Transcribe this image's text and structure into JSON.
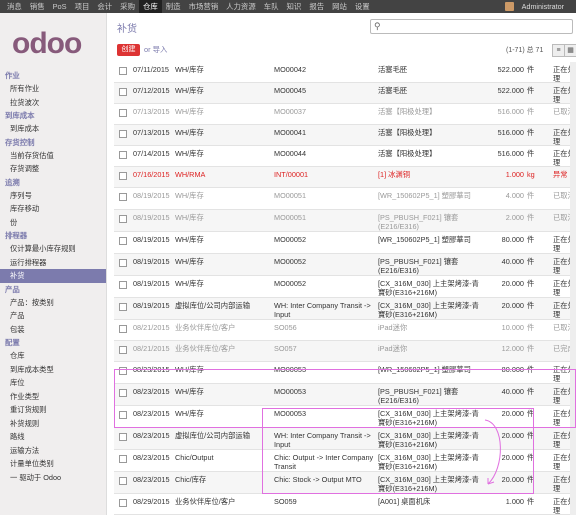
{
  "topbar": {
    "menu": [
      "消息",
      "销售",
      "PoS",
      "项目",
      "会计",
      "采购",
      "仓库",
      "制造",
      "市场营销",
      "人力资源",
      "车队",
      "知识",
      "报告",
      "网站",
      "设置"
    ],
    "active_index": 6,
    "user": "Administrator"
  },
  "logo": "odoo",
  "sidebar": [
    {
      "type": "sec",
      "label": "作业"
    },
    {
      "type": "it",
      "label": "所有作业"
    },
    {
      "type": "it",
      "label": "拉货波次"
    },
    {
      "type": "sec",
      "label": "到库成本"
    },
    {
      "type": "it",
      "label": "到库成本"
    },
    {
      "type": "sec",
      "label": "存货控制"
    },
    {
      "type": "it",
      "label": "当前存货估值"
    },
    {
      "type": "it",
      "label": "存货调整"
    },
    {
      "type": "sec",
      "label": "追溯"
    },
    {
      "type": "it",
      "label": "序列号"
    },
    {
      "type": "it",
      "label": "库存移动"
    },
    {
      "type": "it",
      "label": "份"
    },
    {
      "type": "sec",
      "label": "排程器"
    },
    {
      "type": "it",
      "label": "仅计算最小库存规则"
    },
    {
      "type": "it",
      "label": "运行排程器"
    },
    {
      "type": "it",
      "label": "补货",
      "active": true
    },
    {
      "type": "sec",
      "label": "产品"
    },
    {
      "type": "it",
      "label": "产品：按类别"
    },
    {
      "type": "it",
      "label": "产品"
    },
    {
      "type": "it",
      "label": "包装"
    },
    {
      "type": "sec",
      "label": "配置"
    },
    {
      "type": "it",
      "label": "仓库"
    },
    {
      "type": "it",
      "label": "到库成本类型"
    },
    {
      "type": "it",
      "label": "库位"
    },
    {
      "type": "it",
      "label": "作业类型"
    },
    {
      "type": "it",
      "label": "重订货规则"
    },
    {
      "type": "it",
      "label": "补货规则"
    },
    {
      "type": "it",
      "label": "路线"
    },
    {
      "type": "it",
      "label": "运输方法"
    },
    {
      "type": "it",
      "label": "计量单位类别"
    },
    {
      "type": "it",
      "label": "一 驱动于 Odoo"
    }
  ],
  "breadcrumb": "补货",
  "search": {
    "placeholder": ""
  },
  "toolbar": {
    "create": "创建",
    "or": "or",
    "import": "导入"
  },
  "pager": "(1-71) 总 71",
  "rows": [
    {
      "date": "07/11/2015",
      "loc": "WH/库存",
      "ref": "MO00042",
      "prod": "活塞毛胚",
      "qty": "522.000",
      "uom": "件",
      "st": "正在处理",
      "kind": "normal"
    },
    {
      "date": "07/12/2015",
      "loc": "WH/库存",
      "ref": "MO00045",
      "prod": "活塞毛胚",
      "qty": "522.000",
      "uom": "件",
      "st": "正在处理",
      "kind": "normal"
    },
    {
      "date": "07/13/2015",
      "loc": "WH/库存",
      "ref": "MO00037",
      "prod": "活塞【阳极处理】",
      "qty": "516.000",
      "uom": "件",
      "st": "已取消",
      "kind": "grey"
    },
    {
      "date": "07/13/2015",
      "loc": "WH/库存",
      "ref": "MO00041",
      "prod": "活塞【阳极处理】",
      "qty": "516.000",
      "uom": "件",
      "st": "正在处理",
      "kind": "normal"
    },
    {
      "date": "07/14/2015",
      "loc": "WH/库存",
      "ref": "MO00044",
      "prod": "活塞【阳极处理】",
      "qty": "516.000",
      "uom": "件",
      "st": "正在处理",
      "kind": "normal"
    },
    {
      "date": "07/16/2015",
      "loc": "WH/RMA",
      "ref": "INT/00001",
      "prod": "[1] 冰渊铜",
      "qty": "1.000",
      "uom": "kg",
      "st": "异常",
      "kind": "red"
    },
    {
      "date": "08/19/2015",
      "loc": "WH/库存",
      "ref": "MO00051",
      "prod": "[WR_150602P5_1] 塑膠華司",
      "qty": "4.000",
      "uom": "件",
      "st": "已取消",
      "kind": "grey"
    },
    {
      "date": "08/19/2015",
      "loc": "WH/库存",
      "ref": "MO00051",
      "prod": "[PS_PBUSH_F021] 镶套 (E216/E316)",
      "qty": "2.000",
      "uom": "件",
      "st": "已取消",
      "kind": "grey"
    },
    {
      "date": "08/19/2015",
      "loc": "WH/库存",
      "ref": "MO00052",
      "prod": "[WR_150602P5_1] 塑膠華司",
      "qty": "80.000",
      "uom": "件",
      "st": "正在处理",
      "kind": "normal"
    },
    {
      "date": "08/19/2015",
      "loc": "WH/库存",
      "ref": "MO00052",
      "prod": "[PS_PBUSH_F021] 镶套 (E216/E316)",
      "qty": "40.000",
      "uom": "件",
      "st": "正在处理",
      "kind": "normal"
    },
    {
      "date": "08/19/2015",
      "loc": "WH/库存",
      "ref": "MO00052",
      "prod": "[CX_316M_030] 上主架烤漆-青寶砂(E316+216M)",
      "qty": "20.000",
      "uom": "件",
      "st": "正在处理",
      "kind": "normal"
    },
    {
      "date": "08/19/2015",
      "loc": "虚拟库位/公司内部运输",
      "ref": "WH: Inter Company Transit -> Input",
      "prod": "[CX_316M_030] 上主架烤漆-青寶砂(E316+216M)",
      "qty": "20.000",
      "uom": "件",
      "st": "正在处理",
      "kind": "normal"
    },
    {
      "date": "08/21/2015",
      "loc": "业务伙伴库位/客户",
      "ref": "SO056",
      "prod": "iPad迷你",
      "qty": "10.000",
      "uom": "件",
      "st": "已取消",
      "kind": "grey"
    },
    {
      "date": "08/21/2015",
      "loc": "业务伙伴库位/客户",
      "ref": "SO057",
      "prod": "iPad迷你",
      "qty": "12.000",
      "uom": "件",
      "st": "已完成",
      "kind": "grey"
    },
    {
      "date": "08/23/2015",
      "loc": "WH/库存",
      "ref": "MO00053",
      "prod": "[WR_150602P5_1] 塑膠華司",
      "qty": "80.000",
      "uom": "件",
      "st": "正在处理",
      "kind": "normal"
    },
    {
      "date": "08/23/2015",
      "loc": "WH/库存",
      "ref": "MO00053",
      "prod": "[PS_PBUSH_F021] 镶套 (E216/E316)",
      "qty": "40.000",
      "uom": "件",
      "st": "正在处理",
      "kind": "normal"
    },
    {
      "date": "08/23/2015",
      "loc": "WH/库存",
      "ref": "MO00053",
      "prod": "[CX_316M_030] 上主架烤漆-青寶砂(E316+216M)",
      "qty": "20.000",
      "uom": "件",
      "st": "正在处理",
      "kind": "normal"
    },
    {
      "date": "08/23/2015",
      "loc": "虚拟库位/公司内部运输",
      "ref": "WH: Inter Company Transit -> Input",
      "prod": "[CX_316M_030] 上主架烤漆-青寶砂(E316+216M)",
      "qty": "20.000",
      "uom": "件",
      "st": "正在处理",
      "kind": "normal"
    },
    {
      "date": "08/23/2015",
      "loc": "Chic/Output",
      "ref": "Chic: Output -> Inter Company Transit",
      "prod": "[CX_316M_030] 上主架烤漆-青寶砂(E316+216M)",
      "qty": "20.000",
      "uom": "件",
      "st": "正在处理",
      "kind": "normal"
    },
    {
      "date": "08/23/2015",
      "loc": "Chic/库存",
      "ref": "Chic: Stock -> Output MTO",
      "prod": "[CX_316M_030] 上主架烤漆-青寶砂(E316+216M)",
      "qty": "20.000",
      "uom": "件",
      "st": "正在处理",
      "kind": "normal"
    },
    {
      "date": "08/29/2015",
      "loc": "业务伙伴库位/客户",
      "ref": "SO059",
      "prod": "[A001] 桌面机床",
      "qty": "1.000",
      "uom": "件",
      "st": "正在处理",
      "kind": "normal"
    }
  ]
}
